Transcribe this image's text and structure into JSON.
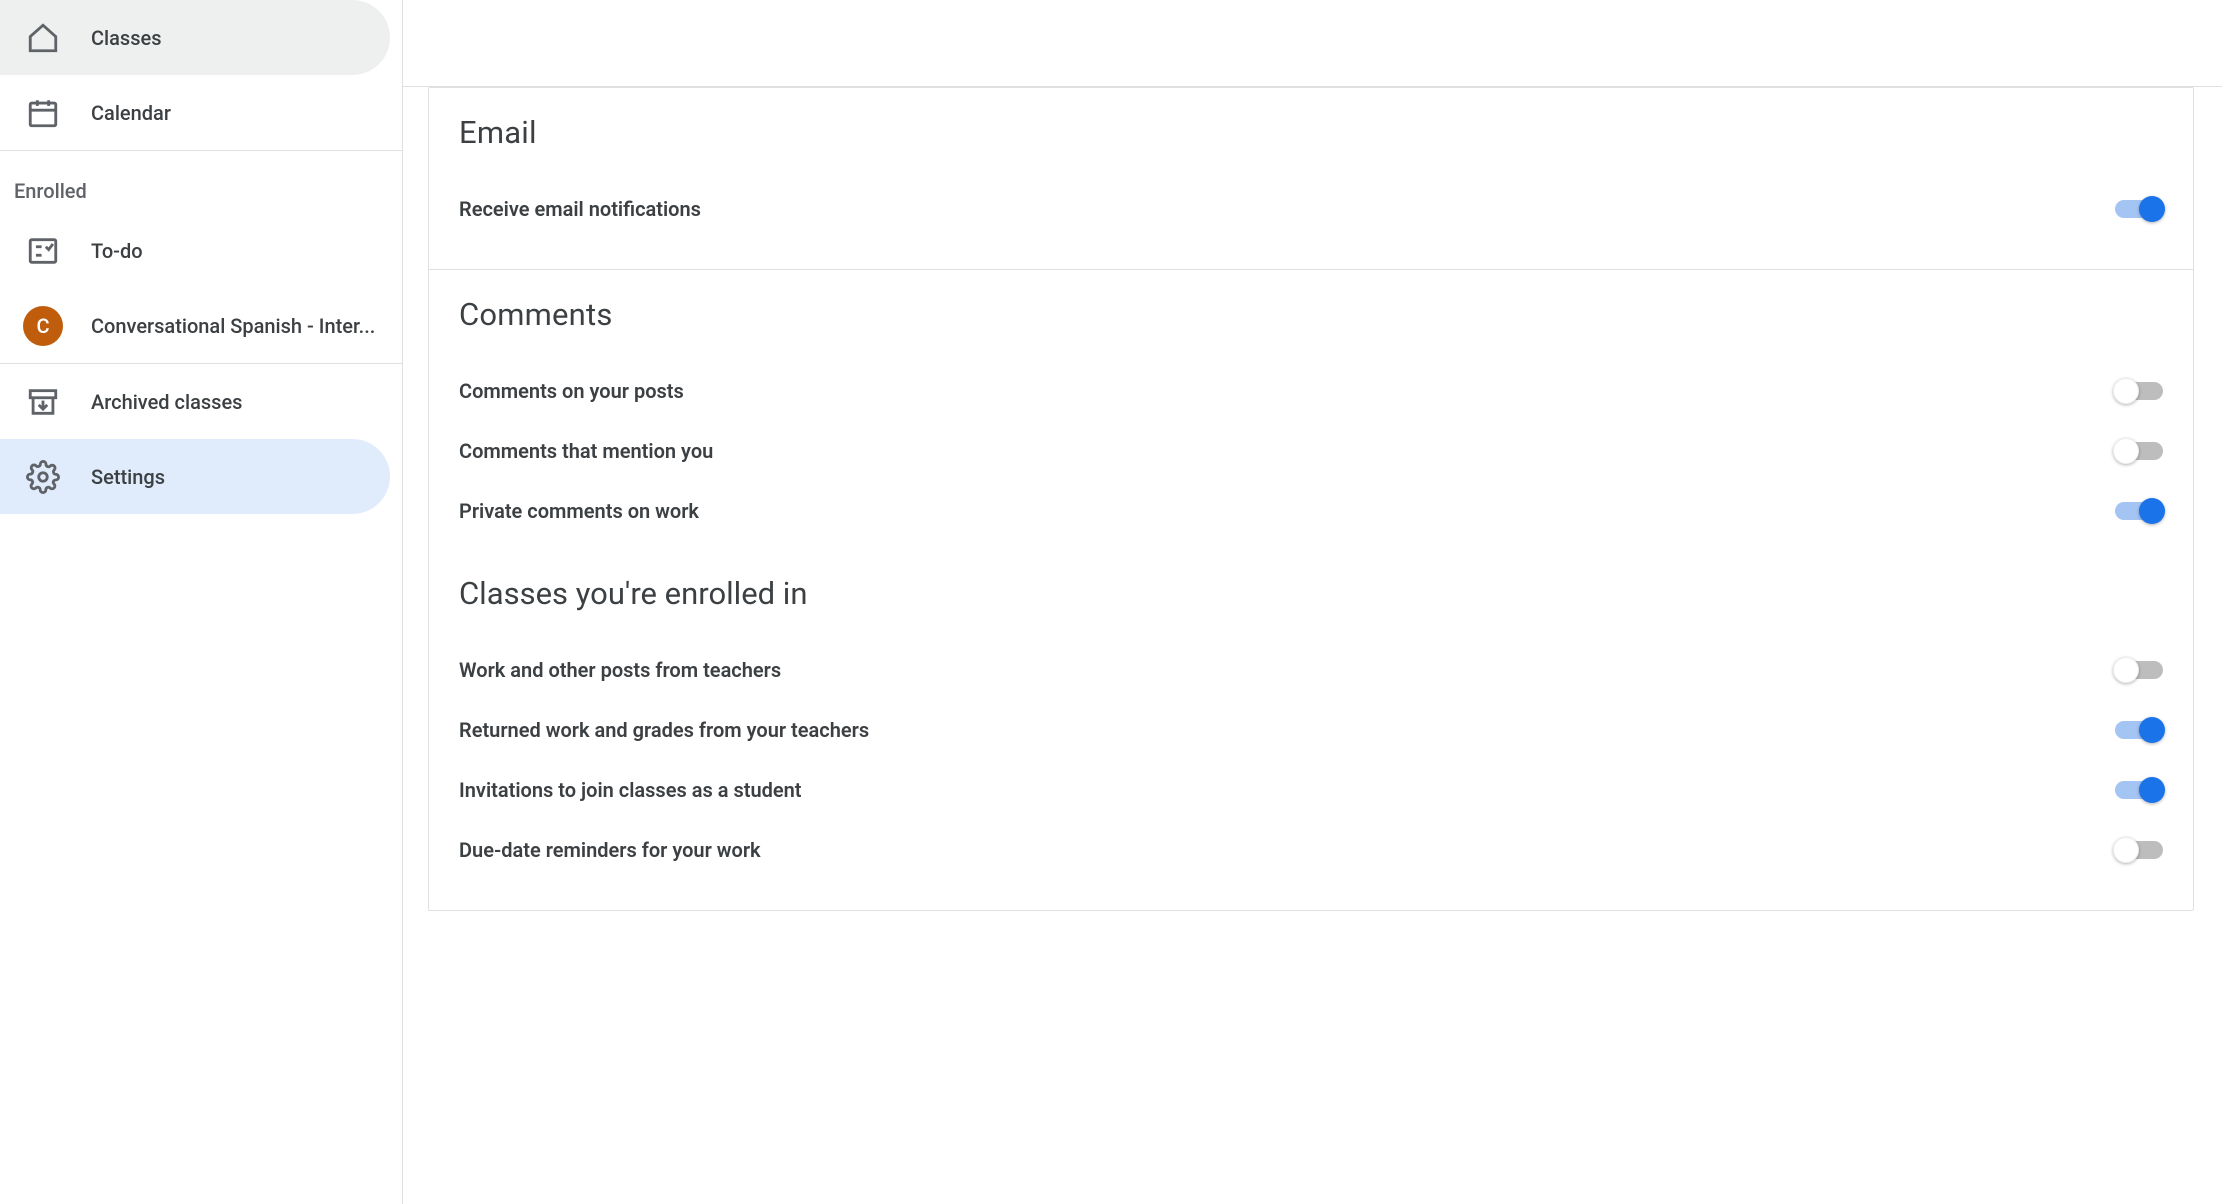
{
  "sidebar": {
    "classes": "Classes",
    "calendar": "Calendar",
    "enrolled_header": "Enrolled",
    "todo": "To-do",
    "class_initial": "C",
    "class_name": "Conversational Spanish - Inter...",
    "archived": "Archived classes",
    "settings": "Settings"
  },
  "settings": {
    "email": {
      "title": "Email",
      "receive": {
        "label": "Receive email notifications",
        "on": true
      }
    },
    "comments": {
      "title": "Comments",
      "posts": {
        "label": "Comments on your posts",
        "on": false
      },
      "mention": {
        "label": "Comments that mention you",
        "on": false
      },
      "private": {
        "label": "Private comments on work",
        "on": true
      }
    },
    "enrolled": {
      "title": "Classes you're enrolled in",
      "work": {
        "label": "Work and other posts from teachers",
        "on": false
      },
      "returned": {
        "label": "Returned work and grades from your teachers",
        "on": true
      },
      "invites": {
        "label": "Invitations to join classes as a student",
        "on": true
      },
      "duedate": {
        "label": "Due-date reminders for your work",
        "on": false
      }
    }
  }
}
